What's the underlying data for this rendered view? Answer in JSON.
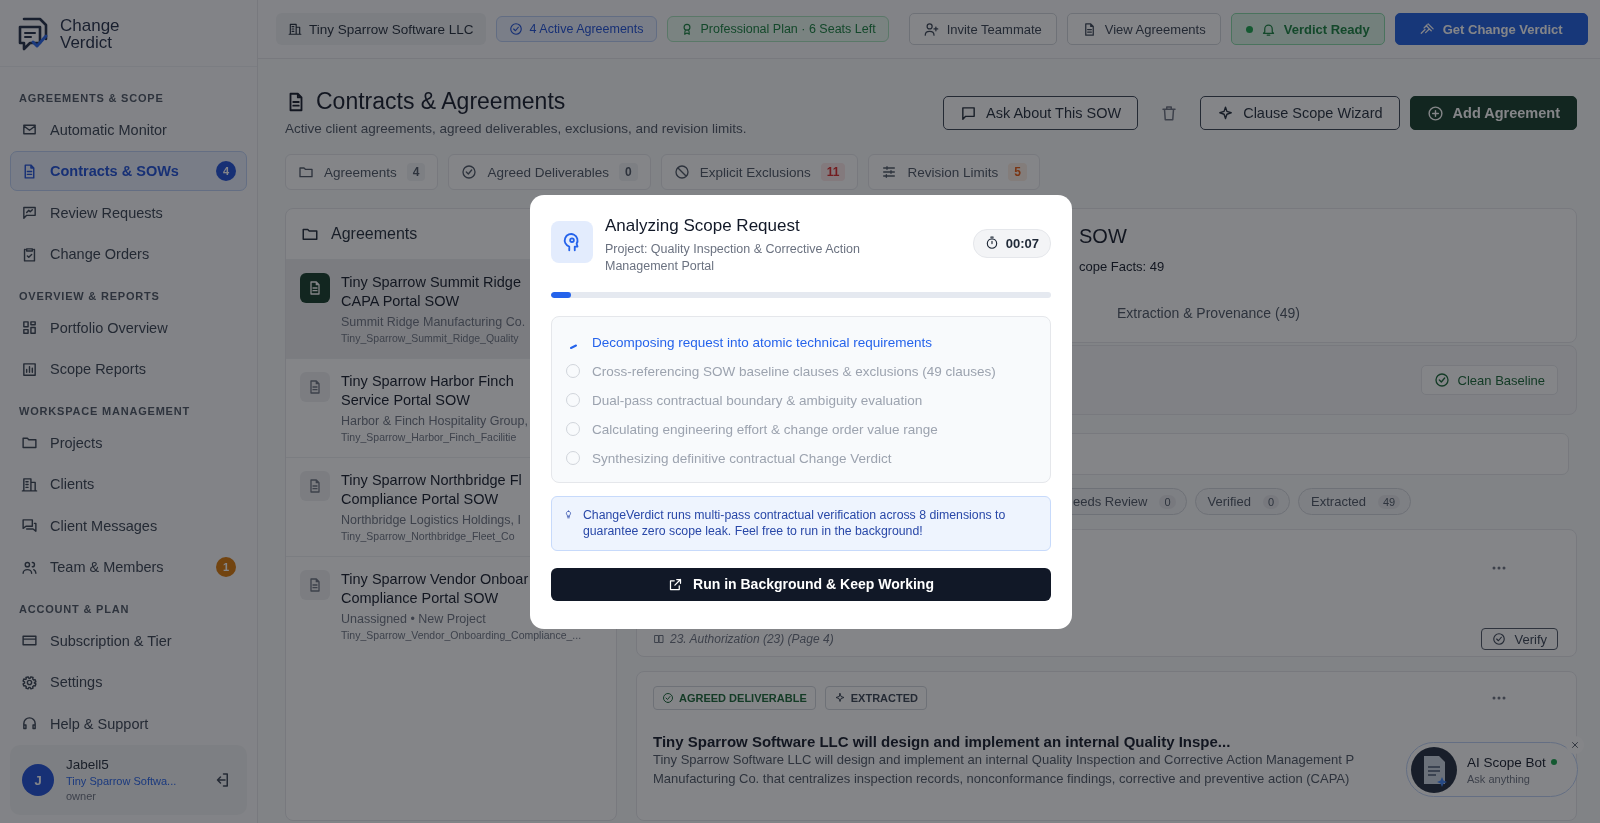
{
  "sidebar": {
    "logo_lines": [
      "Change",
      "Verdict"
    ],
    "sections": [
      {
        "heading": "AGREEMENTS & SCOPE",
        "items": [
          {
            "label": "Automatic Monitor",
            "selected": false
          },
          {
            "label": "Contracts & SOWs",
            "selected": true,
            "badge": {
              "text": "4",
              "kind": "info"
            }
          },
          {
            "label": "Review Requests",
            "selected": false
          },
          {
            "label": "Change Orders",
            "selected": false
          }
        ]
      },
      {
        "heading": "OVERVIEW & REPORTS",
        "items": [
          {
            "label": "Portfolio Overview",
            "selected": false
          },
          {
            "label": "Scope Reports",
            "selected": false
          }
        ]
      },
      {
        "heading": "WORKSPACE MANAGEMENT",
        "items": [
          {
            "label": "Projects",
            "selected": false
          },
          {
            "label": "Clients",
            "selected": false
          },
          {
            "label": "Client Messages",
            "selected": false
          },
          {
            "label": "Team & Members",
            "selected": false,
            "badge": {
              "text": "1",
              "kind": "warning"
            }
          }
        ]
      },
      {
        "heading": "ACCOUNT & PLAN",
        "items": [
          {
            "label": "Subscription & Tier",
            "selected": false
          },
          {
            "label": "Settings",
            "selected": false
          },
          {
            "label": "Help & Support",
            "selected": false
          }
        ]
      }
    ],
    "user": {
      "initial": "J",
      "name": "Jabell5",
      "org": "Tiny Sparrow Softwa...",
      "role": "owner"
    }
  },
  "topbar": {
    "chips": [
      {
        "label": "Tiny Sparrow Software LLC",
        "kind": "org"
      },
      {
        "label": "4 Active Agreements",
        "kind": "info"
      },
      {
        "label": "Professional Plan · 6 Seats Left",
        "kind": "plan"
      }
    ],
    "buttons": [
      {
        "label": "Invite Teammate",
        "kind": "invite"
      },
      {
        "label": "View Agreements",
        "kind": "view"
      },
      {
        "label": "Verdict Ready",
        "kind": "status"
      },
      {
        "label": "Get Change Verdict",
        "kind": "primary"
      }
    ]
  },
  "page": {
    "title": "Contracts & Agreements",
    "subtitle": "Active client agreements, agreed deliverables, exclusions, and revision limits.",
    "actions": [
      {
        "label": "Ask About This SOW",
        "kind": "ask"
      },
      {
        "kind": "delete"
      },
      {
        "label": "Clause Scope Wizard",
        "kind": "wizard"
      },
      {
        "label": "Add Agreement",
        "kind": "add"
      }
    ]
  },
  "tabs": [
    {
      "label": "Agreements",
      "count": "4",
      "kind": "neutral"
    },
    {
      "label": "Agreed Deliverables",
      "count": "0",
      "kind": "neutral"
    },
    {
      "label": "Explicit Exclusions",
      "count": "11",
      "kind": "danger"
    },
    {
      "label": "Revision Limits",
      "count": "5",
      "kind": "warning"
    }
  ],
  "list": {
    "title": "Agreements",
    "items": [
      {
        "title_lines": [
          "Tiny Sparrow Summit Ridge",
          "CAPA Portal SOW"
        ],
        "client": "Summit Ridge Manufacturing Co.",
        "file": "Tiny_Sparrow_Summit_Ridge_Quality",
        "selected": true
      },
      {
        "title_lines": [
          "Tiny Sparrow Harbor Finch",
          "Service Portal SOW"
        ],
        "client": "Harbor & Finch Hospitality Group,",
        "file": "Tiny_Sparrow_Harbor_Finch_Facilitie",
        "selected": false
      },
      {
        "title_lines": [
          "Tiny Sparrow Northbridge Fl",
          "Compliance Portal SOW"
        ],
        "client": "Northbridge Logistics Holdings, I",
        "file": "Tiny_Sparrow_Northbridge_Fleet_Co",
        "selected": false
      },
      {
        "title_lines": [
          "Tiny Sparrow Vendor Onboar",
          "Compliance Portal SOW"
        ],
        "client": "Unassigned • New Project",
        "file": "Tiny_Sparrow_Vendor_Onboarding_Compliance_...",
        "selected": false
      }
    ]
  },
  "detail": {
    "title": "SOW",
    "facts": "cope Facts: 49",
    "tab": "Extraction & Provenance (49)",
    "baseline_button": "Clean Baseline",
    "filters": [
      {
        "label": "eeds Review",
        "count": "0"
      },
      {
        "label": "Verified",
        "count": "0"
      },
      {
        "label": "Extracted",
        "count": "49"
      }
    ],
    "cards": [
      {
        "kind": "source",
        "source": "23. Authorization (23) (Page 4)",
        "action": "Verify"
      },
      {
        "kind": "fact",
        "badges": [
          {
            "label": "AGREED DELIVERABLE",
            "kind": "status"
          },
          {
            "label": "EXTRACTED",
            "kind": "origin"
          }
        ],
        "title": "Tiny Sparrow Software LLC will design and implement an internal Quality Inspe...",
        "body_lines": [
          "Tiny Sparrow Software LLC will design and implement an internal Quality Inspection and Corrective Action Management P",
          "Manufacturing Co. that centralizes inspection records, nonconformance findings, corrective and preventive action (CAPA)"
        ]
      }
    ]
  },
  "modal": {
    "title": "Analyzing Scope Request",
    "project": "Project: Quality Inspection & Corrective Action Management Portal",
    "timer": "00:07",
    "progress": {
      "level": 0.04
    },
    "steps": [
      {
        "label": "Decomposing request into atomic technical requirements",
        "active": true
      },
      {
        "label": "Cross-referencing SOW baseline clauses & exclusions (49 clauses)",
        "active": false
      },
      {
        "label": "Dual-pass contractual boundary & ambiguity evaluation",
        "active": false
      },
      {
        "label": "Calculating engineering effort & change order value range",
        "active": false
      },
      {
        "label": "Synthesizing definitive contractual Change Verdict",
        "active": false
      }
    ],
    "tip": "ChangeVerdict runs multi-pass contractual verification across 8 dimensions to guarantee zero scope leak. Feel free to run in the background!",
    "button": "Run in Background & Keep Working"
  },
  "bot": {
    "name": "AI Scope Bot",
    "online": true,
    "hint": "Ask anything"
  }
}
